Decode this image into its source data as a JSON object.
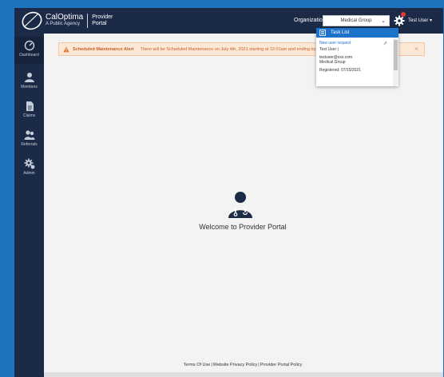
{
  "header": {
    "brand_name": "CalOptima",
    "brand_sub": "A Public Agency",
    "portal_line1": "Provider",
    "portal_line2": "Portal",
    "org_label": "Organization:",
    "org_selected": "Medical Group",
    "user_name": "Test User ▾"
  },
  "sidebar": {
    "items": [
      {
        "label": "Dashboard",
        "icon": "dashboard-gauge-icon"
      },
      {
        "label": "Members",
        "icon": "members-icon"
      },
      {
        "label": "Claims",
        "icon": "claims-document-icon"
      },
      {
        "label": "Referrals",
        "icon": "referrals-icon"
      },
      {
        "label": "Admin",
        "icon": "admin-gear-icon"
      }
    ]
  },
  "alert": {
    "title": "Scheduled Maintenance Alert",
    "message": "There will be Scheduled Maintenance on July 4th, 2021 starting at 12:01am and ending by 5",
    "close": "×"
  },
  "tasklist": {
    "title": "Task List",
    "request_link": "New user request",
    "user": "Test User |",
    "email": "testuser@xxx.com",
    "org": "Medical Group",
    "registered": "Registered: 07/15/2021",
    "external_icon": "⇗"
  },
  "main": {
    "welcome": "Welcome to Provider Portal"
  },
  "footer": {
    "terms": "Terms Of Use",
    "privacy": "Website Privacy Policy",
    "provider_policy": "Provider Portal Policy",
    "separator": "|"
  },
  "colors": {
    "navbar": "#1b2a46",
    "accent": "#1d72c9",
    "alert_bg": "#fde8d6",
    "alert_text": "#c4602a",
    "page_bg": "#f3f3f3"
  }
}
